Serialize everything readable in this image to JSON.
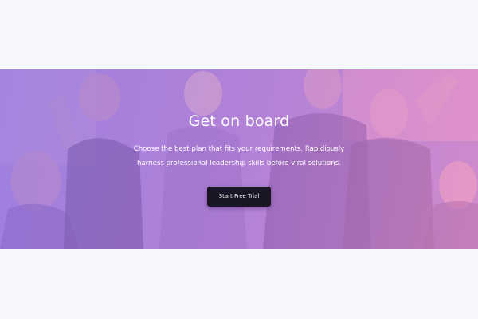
{
  "hero": {
    "title": "Get on board",
    "subtitle": "Choose the best plan that fits your requirements. Rapidiously harness professional leadership skills before viral solutions.",
    "cta_label": "Start Free Trial",
    "colors": {
      "gradient_start": "#9a7fe0",
      "gradient_end": "#ec8fc2",
      "button_bg": "#1b1626",
      "text": "#ffffff",
      "page_bg": "#f6f7fb"
    }
  }
}
